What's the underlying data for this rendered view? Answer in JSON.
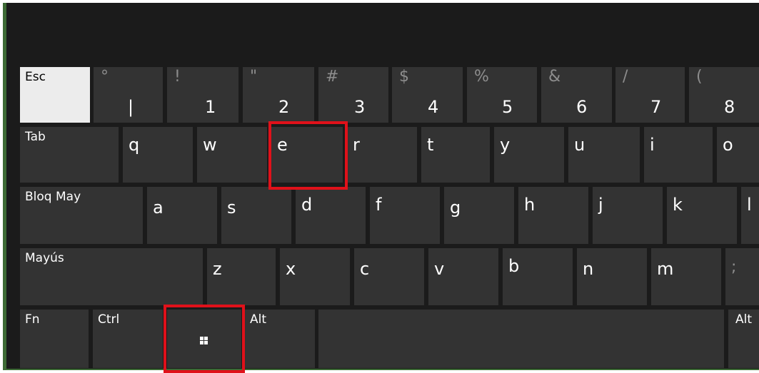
{
  "keyboard": {
    "row1": {
      "esc": "Esc",
      "k1": {
        "shift": "°",
        "main": "|"
      },
      "k2": {
        "shift": "!",
        "main": "1"
      },
      "k3": {
        "shift": "\"",
        "main": "2"
      },
      "k4": {
        "shift": "#",
        "main": "3"
      },
      "k5": {
        "shift": "$",
        "main": "4"
      },
      "k6": {
        "shift": "%",
        "main": "5"
      },
      "k7": {
        "shift": "&",
        "main": "6"
      },
      "k8": {
        "shift": "/",
        "main": "7"
      },
      "k9": {
        "shift": "(",
        "main": "8"
      }
    },
    "row2": {
      "tab": "Tab",
      "keys": [
        "q",
        "w",
        "e",
        "r",
        "t",
        "y",
        "u",
        "i",
        "o"
      ]
    },
    "row3": {
      "caps": "Bloq May",
      "keys": [
        "a",
        "s",
        "d",
        "f",
        "g",
        "h",
        "j",
        "k",
        "l"
      ]
    },
    "row4": {
      "shift": "Mayús",
      "keys": [
        "z",
        "x",
        "c",
        "v",
        "b",
        "n",
        "m",
        ";"
      ]
    },
    "row5": {
      "fn": "Fn",
      "ctrl": "Ctrl",
      "win": "windows-icon",
      "alt": "Alt",
      "altgr": "Alt"
    }
  },
  "highlight_color": "#e0111a"
}
